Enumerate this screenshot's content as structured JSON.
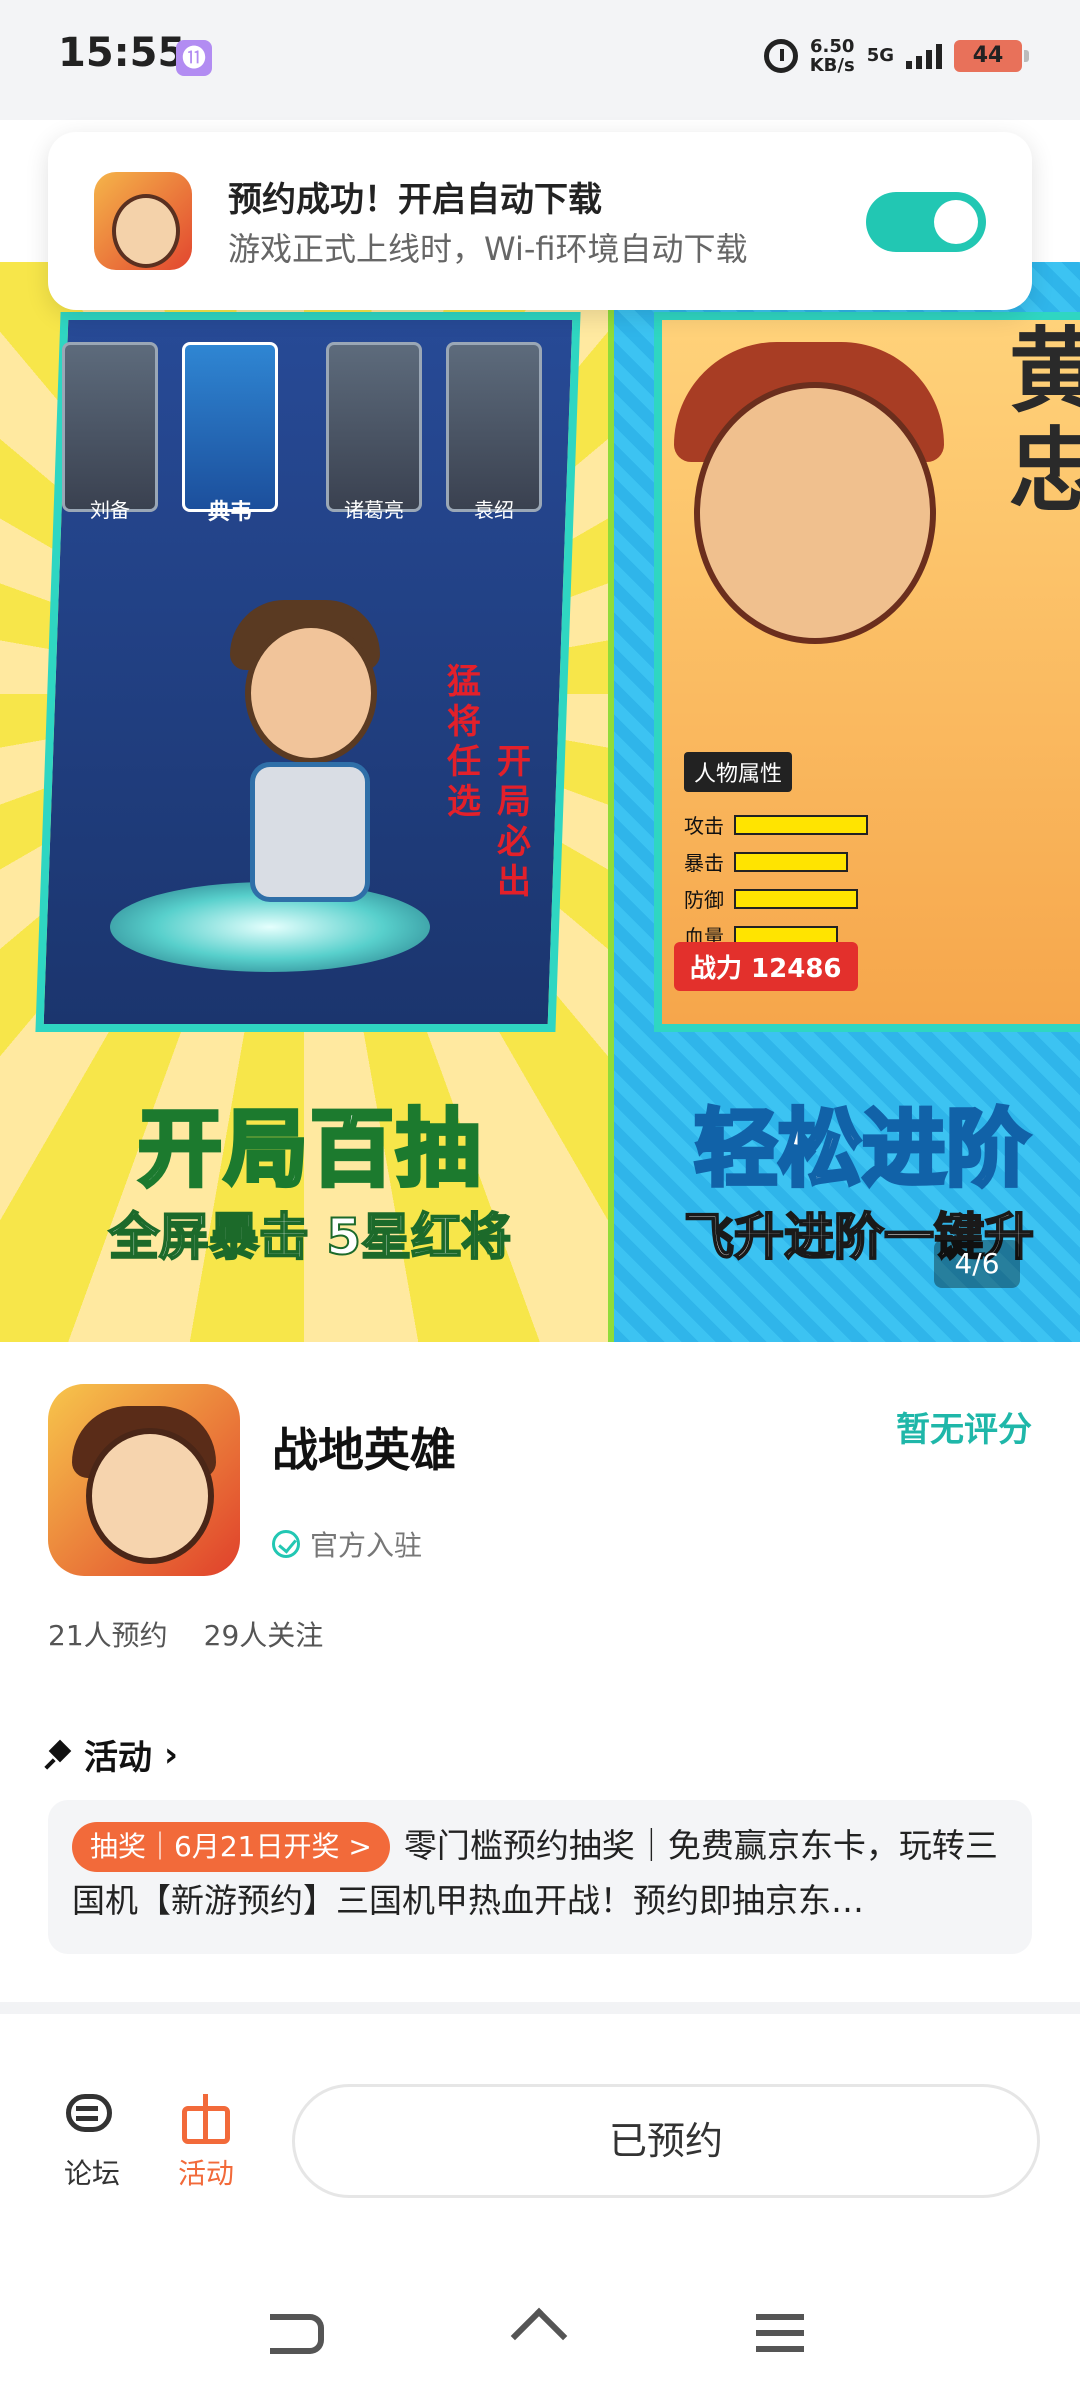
{
  "status_bar": {
    "time": "15:55",
    "app_badge": "⓫",
    "net_speed_value": "6.50",
    "net_speed_unit": "KB/s",
    "network": "5G",
    "battery": "44"
  },
  "toast": {
    "title": "预约成功！开启自动下载",
    "subtitle": "游戏正式上线时，Wi-fi环境自动下载",
    "toggle_on": true
  },
  "gallery": {
    "banner1": {
      "heroes": [
        "刘备",
        "典韦",
        "诸葛亮",
        "袁绍"
      ],
      "side_text_1": "猛将任选",
      "side_text_2": "开局必出",
      "title": "开局百抽",
      "subtitle": "全屏暴击 5星红将"
    },
    "banner2": {
      "big_text": "黄忠",
      "attr_header": "人物属性",
      "attrs": [
        "攻击",
        "暴击",
        "防御",
        "血量"
      ],
      "power": "战力 12486",
      "title": "轻松进阶",
      "subtitle": "飞升进阶一键升"
    },
    "pager": "4/6"
  },
  "game": {
    "name": "战地英雄",
    "official": "官方入驻",
    "rating": "暂无评分",
    "reservations": "21人预约",
    "followers": "29人关注"
  },
  "activity": {
    "header": "活动",
    "tag": "抽奖｜6月21日开奖 >",
    "text": "零门槛预约抽奖｜免费赢京东卡，玩转三国机【新游预约】三国机甲热血开战！预约即抽京东…"
  },
  "bottom_bar": {
    "forum": "论坛",
    "activity": "活动",
    "reserve_button": "已预约"
  },
  "colors": {
    "accent": "#22c7b3",
    "orange": "#f26a3a"
  }
}
